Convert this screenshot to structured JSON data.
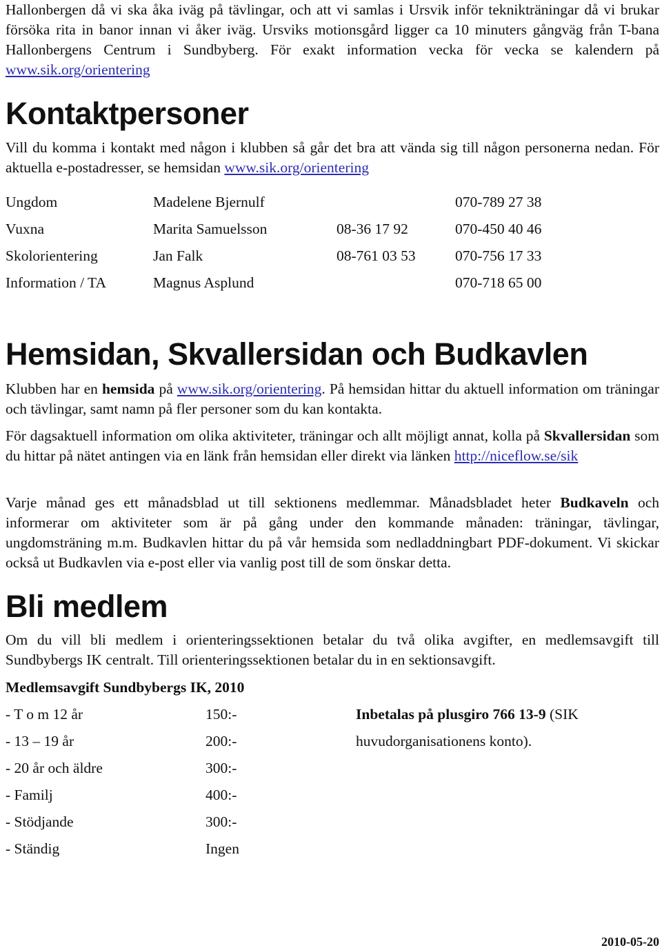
{
  "intro": {
    "line1": "Hallonbergen då vi ska åka iväg på tävlingar, och att vi samlas i Ursvik inför teknikträningar då vi brukar försöka rita in banor innan vi åker iväg. Ursviks motionsgård ligger ca 10 minuters gångväg från T-bana Hallonbergens Centrum i Sundbyberg. För exakt information vecka för vecka se kalendern på ",
    "link": "www.sik.org/orientering"
  },
  "kontakt": {
    "heading": "Kontaktpersoner",
    "text": "Vill du komma i kontakt med någon i klubben så går det bra att vända sig till någon personerna nedan. För aktuella e-postadresser, se hemsidan ",
    "link": "www.sik.org/orientering",
    "rows": [
      {
        "role": "Ungdom",
        "name": "Madelene Bjernulf",
        "phone": "",
        "mobile": "070-789 27 38"
      },
      {
        "role": "Vuxna",
        "name": "Marita Samuelsson",
        "phone": "08-36 17 92",
        "mobile": "070-450 40 46"
      },
      {
        "role": "Skolorientering",
        "name": "Jan Falk",
        "phone": "08-761 03 53",
        "mobile": "070-756 17 33"
      },
      {
        "role": "Information / TA",
        "name": "Magnus Asplund",
        "phone": "",
        "mobile": "070-718 65 00"
      }
    ]
  },
  "hemsidan": {
    "heading": "Hemsidan, Skvallersidan och Budkavlen",
    "p1_a": "Klubben har en ",
    "p1_bold": "hemsida",
    "p1_b": " på ",
    "p1_link": "www.sik.org/orientering",
    "p1_c": ". På hemsidan hittar du aktuell information om träningar och tävlingar, samt namn på fler personer som du kan kontakta.",
    "p2_a": "För dagsaktuell information om olika aktiviteter, träningar och allt möjligt annat, kolla på ",
    "p2_bold": "Skvallersidan",
    "p2_b": " som du hittar på nätet antingen via en länk från hemsidan eller direkt via länken ",
    "p2_link": "http://niceflow.se/sik",
    "p3_a": "Varje månad ges ett månadsblad ut till sektionens medlemmar. Månadsbladet heter ",
    "p3_bold": "Budkaveln",
    "p3_b": " och informerar om aktiviteter som är på gång under den kommande månaden: träningar, tävlingar, ungdomsträning m.m. Budkavlen hittar du på vår hemsida som nedladdningbart PDF-dokument. Vi skickar också ut Budkavlen via e-post eller via vanlig post till de som önskar detta."
  },
  "medlem": {
    "heading": "Bli medlem",
    "text": "Om du vill bli medlem i orienteringssektionen betalar du två olika avgifter, en medlemsavgift till Sundbybergs IK centralt. Till orienteringssektionen betalar du in en sektionsavgift.",
    "fee_title": "Medlemsavgift Sundbybergs IK, 2010",
    "fees": [
      {
        "label": "- T o m 12 år",
        "amount": "150:-"
      },
      {
        "label": "- 13 – 19 år",
        "amount": "200:-"
      },
      {
        "label": "- 20 år och äldre",
        "amount": "300:-"
      },
      {
        "label": "- Familj",
        "amount": "400:-"
      },
      {
        "label": "- Stödjande",
        "amount": "300:-"
      },
      {
        "label": "- Ständig",
        "amount": "Ingen"
      }
    ],
    "payment_bold": "Inbetalas på plusgiro 766 13-9",
    "payment_a": " (SIK",
    "payment_b": "huvudorganisationens konto)."
  },
  "footer": {
    "date": "2010-05-20"
  }
}
